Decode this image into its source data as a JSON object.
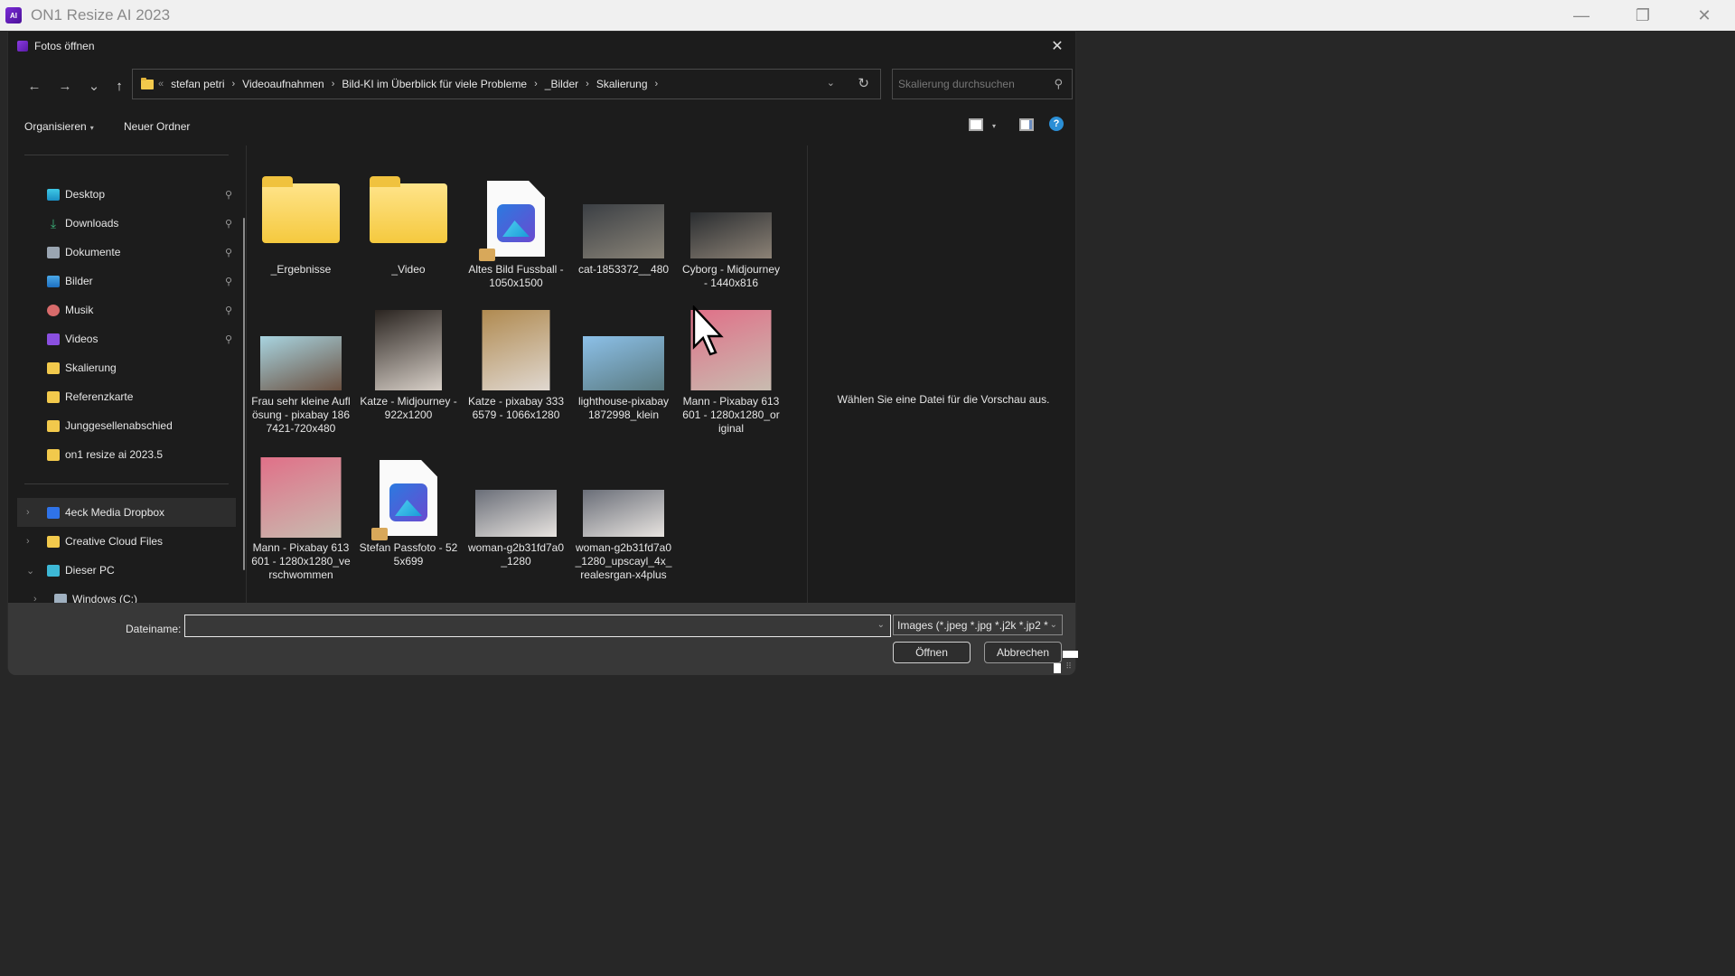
{
  "app": {
    "title": "ON1 Resize AI 2023",
    "logo_text": "AI",
    "window_controls": {
      "minimize": "—",
      "maximize": "❐",
      "close": "✕"
    }
  },
  "dialog": {
    "title": "Fotos öffnen",
    "close_icon": "✕",
    "nav": {
      "back_icon": "←",
      "forward_icon": "→",
      "recent_icon": "⌄",
      "up_icon": "↑"
    },
    "address": {
      "overflow": "«",
      "breadcrumbs": [
        "stefan petri",
        "Videoaufnahmen",
        "Bild-KI im Überblick für viele Probleme",
        "_Bilder",
        "Skalierung"
      ],
      "separator": "›",
      "dropdown_icon": "⌄",
      "refresh_icon": "↻"
    },
    "search": {
      "placeholder": "Skalierung durchsuchen",
      "value": "",
      "icon": "⚲"
    },
    "commands": {
      "organize": "Organisieren",
      "organize_caret": "▾",
      "new_folder": "Neuer Ordner",
      "view_caret": "▾",
      "help": "?"
    },
    "sidebar": {
      "quick_access": [
        {
          "label": "Desktop",
          "icon": "desktop",
          "pinned": true
        },
        {
          "label": "Downloads",
          "icon": "download",
          "pinned": true
        },
        {
          "label": "Dokumente",
          "icon": "documents",
          "pinned": true
        },
        {
          "label": "Bilder",
          "icon": "pictures",
          "pinned": true
        },
        {
          "label": "Musik",
          "icon": "music",
          "pinned": true
        },
        {
          "label": "Videos",
          "icon": "videos",
          "pinned": true
        },
        {
          "label": "Skalierung",
          "icon": "folder",
          "pinned": false
        },
        {
          "label": "Referenzkarte",
          "icon": "folder",
          "pinned": false
        },
        {
          "label": "Junggesellenabschied",
          "icon": "folder",
          "pinned": false
        },
        {
          "label": "on1 resize ai 2023.5",
          "icon": "folder",
          "pinned": false
        }
      ],
      "locations": [
        {
          "label": "4eck Media Dropbox",
          "icon": "dropbox",
          "chevron": "›",
          "selected": true
        },
        {
          "label": "Creative Cloud Files",
          "icon": "creative-cloud",
          "chevron": "›",
          "selected": false
        },
        {
          "label": "Dieser PC",
          "icon": "pc",
          "chevron": "⌄",
          "selected": false
        },
        {
          "label": "Windows (C:)",
          "icon": "drive",
          "chevron": "›",
          "selected": false
        }
      ],
      "pin_icon": "📌"
    },
    "files": [
      {
        "name": "_Ergebnisse",
        "type": "folder"
      },
      {
        "name": "_Video",
        "type": "folder"
      },
      {
        "name": "Altes Bild Fussball - 1050x1500",
        "type": "image-file"
      },
      {
        "name": "cat-1853372__480",
        "type": "photo",
        "thumb_colors": [
          "#3b3f44",
          "#8a8478"
        ]
      },
      {
        "name": "Cyborg - Midjourney - 1440x816",
        "type": "photo",
        "thumb_colors": [
          "#2a2d30",
          "#8c8276"
        ]
      },
      {
        "name": "Frau sehr kleine Auflösung - pixabay 1867421-720x480",
        "type": "photo",
        "thumb_colors": [
          "#a8d4e0",
          "#6a5040"
        ]
      },
      {
        "name": "Katze - Midjourney - 922x1200",
        "type": "photo",
        "thumb_colors": [
          "#2a2420",
          "#d8d0c8"
        ]
      },
      {
        "name": "Katze - pixabay 3336579 - 1066x1280",
        "type": "photo",
        "thumb_colors": [
          "#b08a50",
          "#e0d8d0"
        ]
      },
      {
        "name": "lighthouse-pixabay 1872998_klein",
        "type": "photo",
        "thumb_colors": [
          "#8cc0e8",
          "#5a7a80"
        ]
      },
      {
        "name": "Mann - Pixabay 613601 - 1280x1280_original",
        "type": "photo",
        "thumb_colors": [
          "#e07088",
          "#c8bcb0"
        ]
      },
      {
        "name": "Mann - Pixabay 613601 - 1280x1280_verschwommen",
        "type": "photo",
        "thumb_colors": [
          "#e07088",
          "#c8bcb0"
        ]
      },
      {
        "name": "Stefan Passfoto - 525x699",
        "type": "image-file"
      },
      {
        "name": "woman-g2b31fd7a0_1280",
        "type": "photo",
        "thumb_colors": [
          "#6a6e78",
          "#e8e4e0"
        ]
      },
      {
        "name": "woman-g2b31fd7a0_1280_upscayl_4x_realesrgan-x4plus",
        "type": "photo",
        "thumb_colors": [
          "#6a6e78",
          "#e8e4e0"
        ]
      }
    ],
    "preview": {
      "message": "Wählen Sie eine Datei für die Vorschau aus."
    },
    "footer": {
      "filename_label": "Dateiname:",
      "filename_value": "",
      "filename_caret": "⌄",
      "filter": "Images (*.jpeg *.jpg *.j2k *.jp2 *",
      "filter_caret": "⌄",
      "open_button": "Öffnen",
      "cancel_button": "Abbrechen",
      "resize_grip": "⠿"
    }
  }
}
